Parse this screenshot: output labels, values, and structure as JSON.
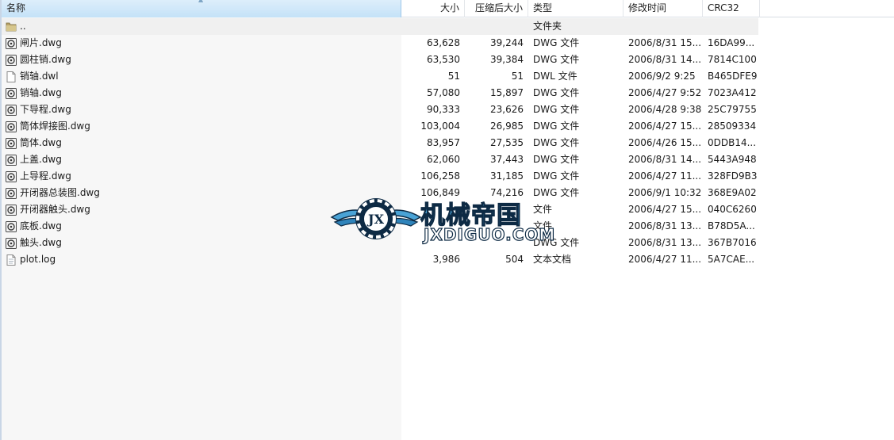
{
  "columns": {
    "name": "名称",
    "size": "大小",
    "packed": "压缩后大小",
    "type": "类型",
    "mtime": "修改时间",
    "crc": "CRC32"
  },
  "parent_row": {
    "name": "..",
    "type": "文件夹",
    "icon": "folder-icon"
  },
  "files": [
    {
      "name": "闸片.dwg",
      "size": "63,628",
      "packed": "39,244",
      "type": "DWG 文件",
      "mtime": "2006/8/31 15...",
      "crc": "16DA99...",
      "icon": "dwg-file-icon"
    },
    {
      "name": "圆柱销.dwg",
      "size": "63,530",
      "packed": "39,384",
      "type": "DWG 文件",
      "mtime": "2006/8/31 14...",
      "crc": "7814C100",
      "icon": "dwg-file-icon"
    },
    {
      "name": "销轴.dwl",
      "size": "51",
      "packed": "51",
      "type": "DWL 文件",
      "mtime": "2006/9/2 9:25",
      "crc": "B465DFE9",
      "icon": "blank-file-icon"
    },
    {
      "name": "销轴.dwg",
      "size": "57,080",
      "packed": "15,897",
      "type": "DWG 文件",
      "mtime": "2006/4/27 9:52",
      "crc": "7023A412",
      "icon": "dwg-file-icon"
    },
    {
      "name": "下导程.dwg",
      "size": "90,333",
      "packed": "23,626",
      "type": "DWG 文件",
      "mtime": "2006/4/28 9:38",
      "crc": "25C79755",
      "icon": "dwg-file-icon"
    },
    {
      "name": "筒体焊接图.dwg",
      "size": "103,004",
      "packed": "26,985",
      "type": "DWG 文件",
      "mtime": "2006/4/27 15...",
      "crc": "28509334",
      "icon": "dwg-file-icon"
    },
    {
      "name": "筒体.dwg",
      "size": "83,957",
      "packed": "27,535",
      "type": "DWG 文件",
      "mtime": "2006/4/26 15...",
      "crc": "0DDB14...",
      "icon": "dwg-file-icon"
    },
    {
      "name": "上盖.dwg",
      "size": "62,060",
      "packed": "37,443",
      "type": "DWG 文件",
      "mtime": "2006/8/31 14...",
      "crc": "5443A948",
      "icon": "dwg-file-icon"
    },
    {
      "name": "上导程.dwg",
      "size": "106,258",
      "packed": "31,185",
      "type": "DWG 文件",
      "mtime": "2006/4/27 11...",
      "crc": "328FD9B3",
      "icon": "dwg-file-icon"
    },
    {
      "name": "开闭器总装图.dwg",
      "size": "106,849",
      "packed": "74,216",
      "type": "DWG 文件",
      "mtime": "2006/9/1 10:32",
      "crc": "368E9A02",
      "icon": "dwg-file-icon"
    },
    {
      "name": "开闭器触头.dwg",
      "size": "",
      "packed": "",
      "type": "文件",
      "mtime": "2006/4/27 15...",
      "crc": "040C6260",
      "icon": "dwg-file-icon"
    },
    {
      "name": "底板.dwg",
      "size": "",
      "packed": "",
      "type": "文件",
      "mtime": "2006/8/31 13...",
      "crc": "B78D5A...",
      "icon": "dwg-file-icon"
    },
    {
      "name": "触头.dwg",
      "size": "",
      "packed": "",
      "type": "DWG 文件",
      "mtime": "2006/8/31 13...",
      "crc": "367B7016",
      "icon": "dwg-file-icon"
    },
    {
      "name": "plot.log",
      "size": "3,986",
      "packed": "504",
      "type": "文本文档",
      "mtime": "2006/4/27 11...",
      "crc": "5A7CAE...",
      "icon": "text-file-icon"
    }
  ],
  "watermark": {
    "title": "机械帝国",
    "url": "JXDIGUO.COM",
    "badge": "JX",
    "icon": "gear-wings-logo-icon"
  },
  "colors": {
    "header_active": "#c4e2f8",
    "watermark_blue": "#4aa3d6",
    "watermark_outline": "#0d2a44"
  }
}
